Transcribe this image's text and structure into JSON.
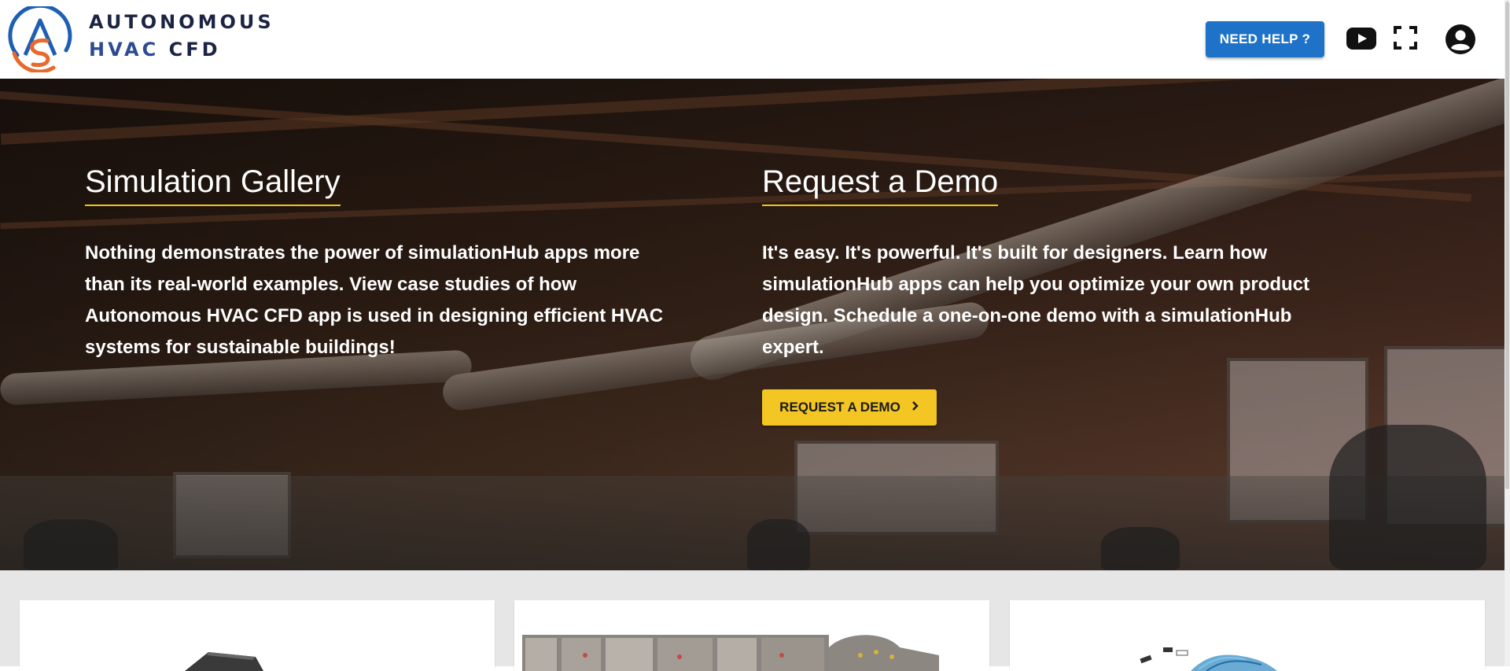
{
  "brand": {
    "line1": "AUTONOMOUS",
    "line2_a": "HVAC",
    "line2_b": "CFD"
  },
  "header": {
    "help_label": "NEED HELP ?",
    "icons": [
      "youtube-icon",
      "fullscreen-icon",
      "account-icon"
    ]
  },
  "colors": {
    "primary": "#1e73c8",
    "accent": "#f3c623",
    "brand_orange": "#e8692b",
    "brand_blue": "#1e5fb4"
  },
  "hero": {
    "gallery": {
      "title": "Simulation Gallery",
      "text_1": "Nothing demonstrates the power of simulationHub apps more than its real-world examples. View case studies of how ",
      "text_bold": "Autonomous HVAC CFD",
      "text_2": " app is used in designing efficient HVAC systems for sustainable buildings!"
    },
    "demo": {
      "title": "Request a Demo",
      "text": "It's easy. It's powerful. It's built for designers. Learn how simulationHub apps can help you optimize your own product design. Schedule a one-on-one demo with a simulationHub expert.",
      "button_label": "REQUEST A DEMO"
    }
  }
}
